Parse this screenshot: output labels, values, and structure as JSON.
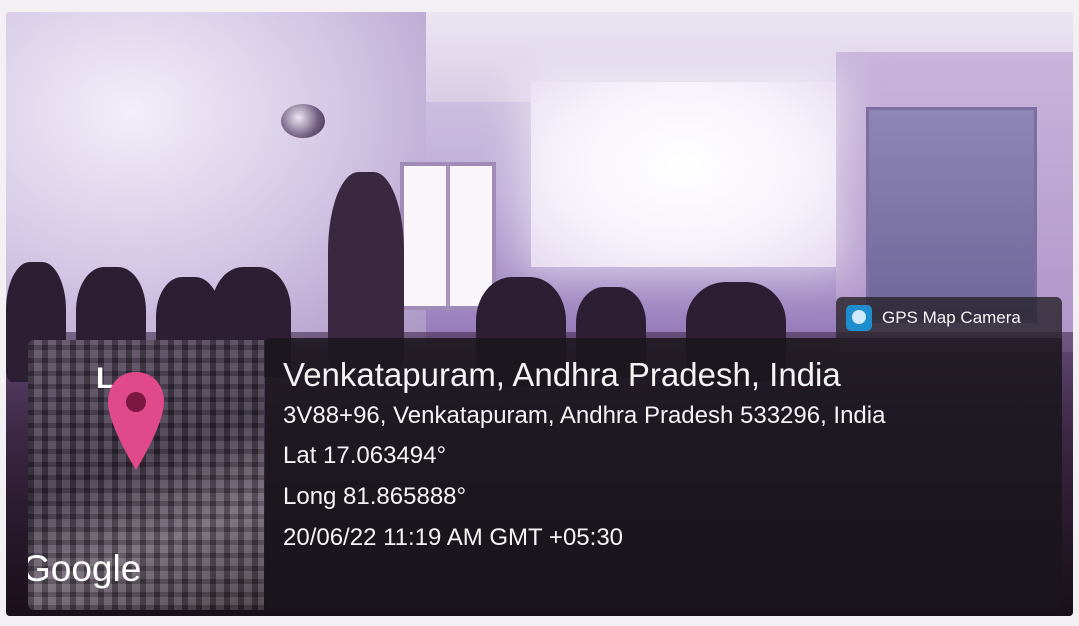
{
  "badge": {
    "label": "GPS Map Camera",
    "icon": "camera-app-icon"
  },
  "location": {
    "title": "Venkatapuram, Andhra Pradesh, India",
    "address": "3V88+96, Venkatapuram, Andhra Pradesh 533296, India",
    "latitude": "Lat 17.063494°",
    "longitude": "Long 81.865888°",
    "datetime": "20/06/22 11:19 AM GMT +05:30"
  },
  "map": {
    "provider": "Google",
    "corner_letter": "L",
    "pin_color": "#e0498a",
    "pin_icon": "map-pin-icon"
  },
  "colors": {
    "panel_bg": "#1a161c",
    "text": "#f4f4f4",
    "badge_icon": "#1f8ecf"
  }
}
